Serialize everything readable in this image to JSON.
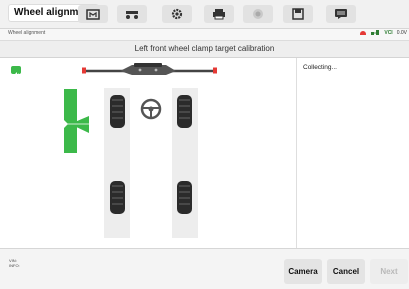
{
  "app": {
    "title": "Wheel alignment"
  },
  "toolbar": {
    "icons": [
      "home-icon",
      "vehicle-lift-icon",
      "gear-icon",
      "printer-icon",
      "camera-lens-icon",
      "save-icon",
      "message-icon"
    ]
  },
  "subbar": {
    "breadcrumb": "Wheel alignment",
    "vci_label": "VCI",
    "extra_label": "0.0V"
  },
  "panel": {
    "title": "Left front wheel clamp target calibration"
  },
  "status_panel": {
    "text": "Collecting..."
  },
  "footer": {
    "vin_label": "VIN:",
    "info_label": "INFO:",
    "camera_label": "Camera",
    "cancel_label": "Cancel",
    "next_label": "Next"
  },
  "colors": {
    "accent_green": "#3cb94a",
    "target_red": "#e53935",
    "next_disabled": "#b9b9b9"
  }
}
